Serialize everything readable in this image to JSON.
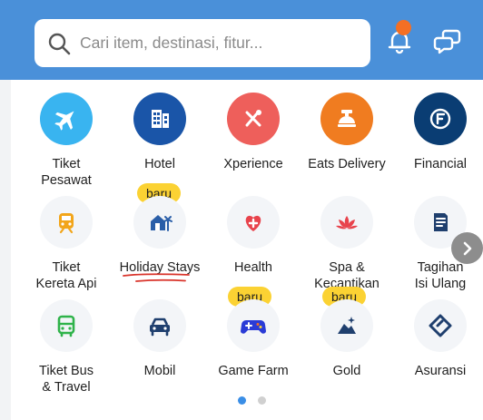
{
  "search": {
    "placeholder": "Cari item, destinasi, fitur..."
  },
  "header": {
    "notification_badge_color": "#f36f24",
    "background_color": "#4a90d9"
  },
  "rows": [
    [
      {
        "label": "Tiket\nPesawat",
        "icon": "airplane-icon",
        "color": "#39b4f0"
      },
      {
        "label": "Hotel",
        "icon": "hotel-icon",
        "color": "#1a55a8"
      },
      {
        "label": "Xperience",
        "icon": "xperience-icon",
        "color": "#ee5f5b"
      },
      {
        "label": "Eats Delivery",
        "icon": "food-tray-icon",
        "color": "#f07c20"
      },
      {
        "label": "Financial",
        "icon": "financial-icon",
        "color": "#0a3d73"
      }
    ],
    [
      {
        "label": "Tiket\nKereta Api",
        "icon": "train-icon",
        "color": "#f2a51a",
        "badge": ""
      },
      {
        "label": "Holiday Stays",
        "icon": "villa-icon",
        "color": "#2a5ea8",
        "badge": "baru"
      },
      {
        "label": "Health",
        "icon": "health-icon",
        "color": "#e8434c"
      },
      {
        "label": "Spa &\nKecantikan",
        "icon": "lotus-icon",
        "color": "#e8434c"
      },
      {
        "label": "Tagihan\nIsi Ulang",
        "icon": "bill-icon",
        "color": "#1f3f6e"
      }
    ],
    [
      {
        "label": "Tiket Bus\n& Travel",
        "icon": "bus-icon",
        "color": "#2fb34a"
      },
      {
        "label": "Mobil",
        "icon": "car-icon",
        "color": "#1f3f6e"
      },
      {
        "label": "Game Farm",
        "icon": "gamepad-icon",
        "color": "#2a3bd6",
        "badge": "baru"
      },
      {
        "label": "Gold",
        "icon": "gold-icon",
        "color": "#1f3f6e",
        "badge": "baru"
      },
      {
        "label": "Asuransi",
        "icon": "insurance-icon",
        "color": "#1f3f6e"
      }
    ]
  ],
  "pagination": {
    "active_color": "#3a8ee6",
    "inactive_color": "#d0d0d0"
  }
}
